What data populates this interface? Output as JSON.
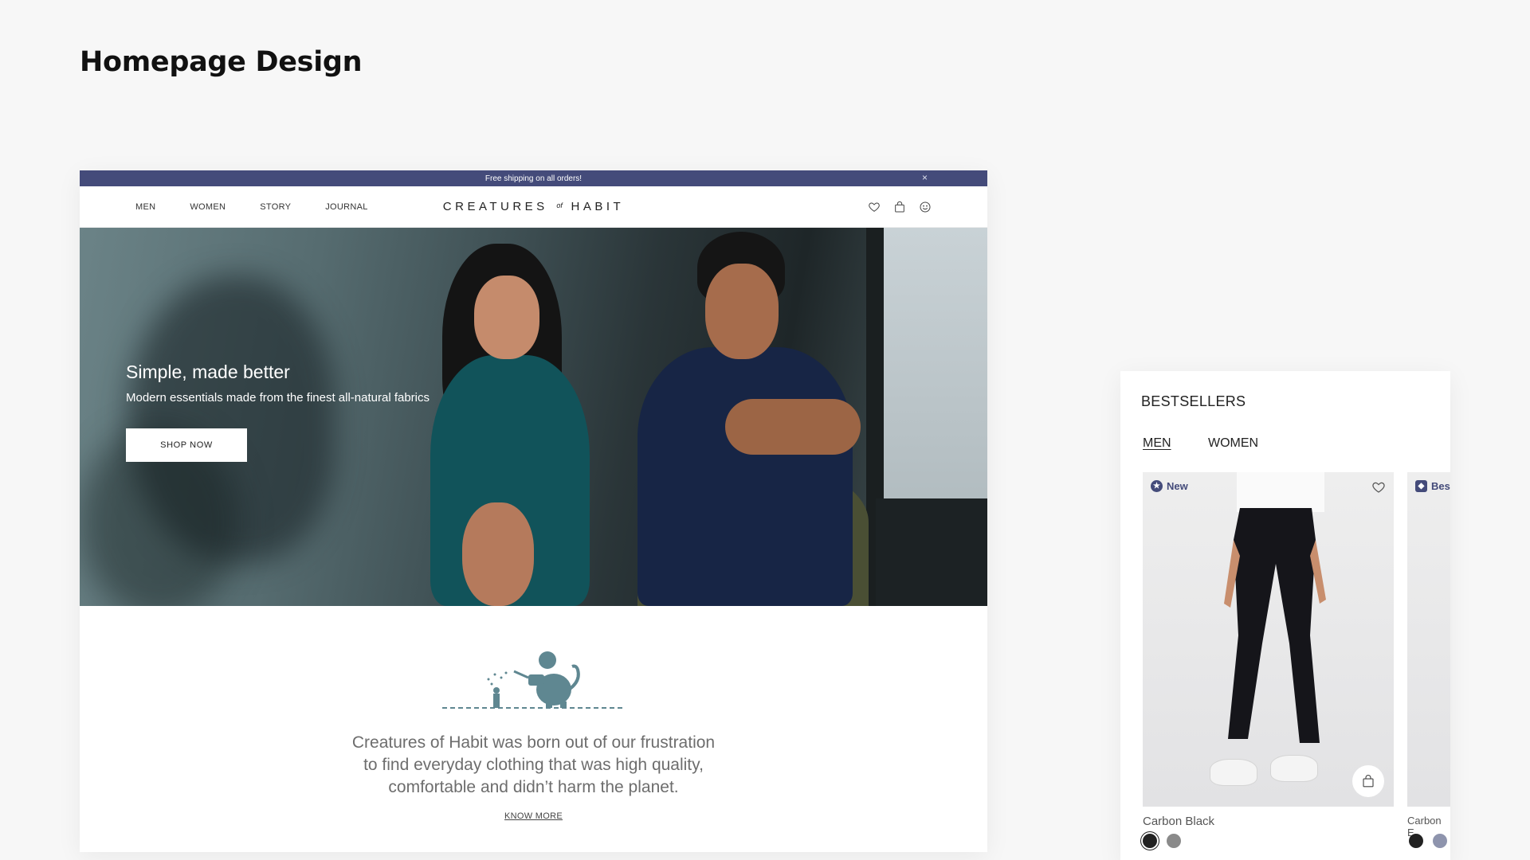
{
  "page": {
    "title": "Homepage Design"
  },
  "announcement": {
    "text": "Free shipping on all orders!",
    "close": "×"
  },
  "nav": {
    "links": [
      "MEN",
      "WOMEN",
      "STORY",
      "JOURNAL"
    ],
    "logo_left": "CREATURES",
    "logo_of": "of",
    "logo_right": "HABIT",
    "icons": [
      "heart-icon",
      "bag-icon",
      "account-icon"
    ]
  },
  "hero": {
    "title": "Simple, made better",
    "subtitle": "Modern essentials made from the finest all-natural fabrics",
    "cta": "SHOP NOW"
  },
  "about": {
    "line1": "Creatures of Habit was born out of our frustration",
    "line2": "to find everyday clothing that was high quality,",
    "line3": "comfortable and didn’t harm the planet.",
    "link": "KNOW MORE"
  },
  "bestsellers": {
    "title": "BESTSELLERS",
    "tabs": [
      "MEN",
      "WOMEN"
    ],
    "products": [
      {
        "badge": "New",
        "name": "Carbon Black",
        "swatches": [
          "#222222",
          "#8a8a8a"
        ]
      },
      {
        "badge": "Bes",
        "name": "Carbon E",
        "swatches": [
          "#222222",
          "#8e94ad"
        ]
      }
    ]
  },
  "colors": {
    "accent": "#444b7a",
    "background": "#f7f7f7"
  }
}
